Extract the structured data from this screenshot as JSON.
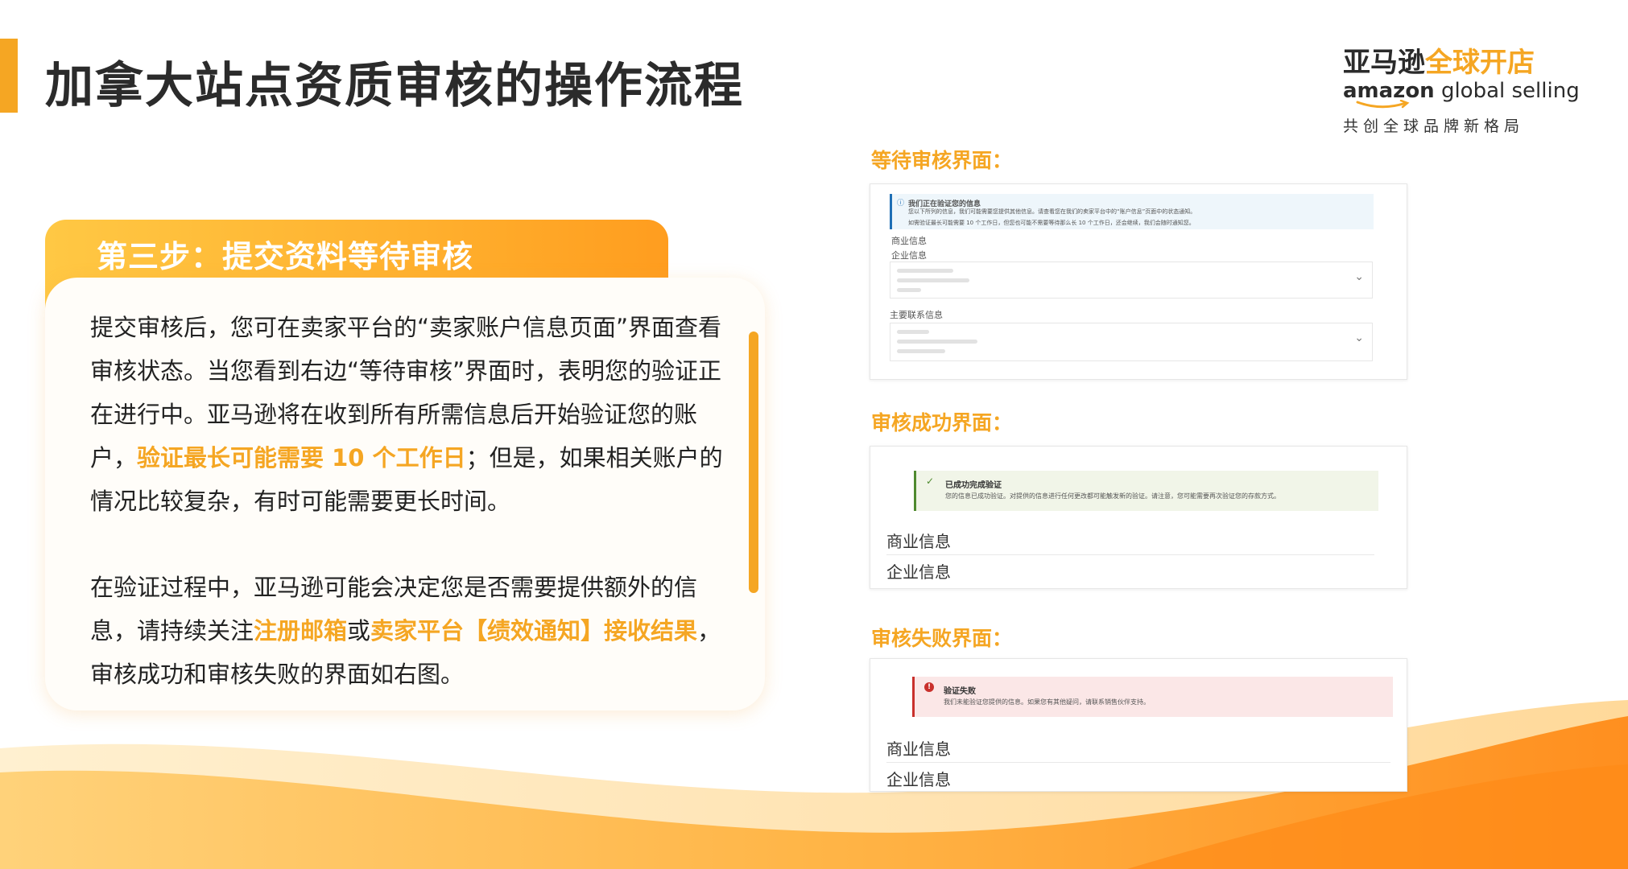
{
  "page": {
    "title": "加拿大站点资质审核的操作流程"
  },
  "logo": {
    "cn_part1": "亚马逊",
    "cn_part2": "全球开店",
    "en_part1": "amazon",
    "en_part2": " global selling",
    "tagline": "共创全球品牌新格局"
  },
  "step": {
    "title": "第三步：提交资料等待审核",
    "para1": {
      "text1": "提交审核后，您可在卖家平台的“卖家账户信息页面”界面查看审核状态。当您看到右边“等待审核”界面时，表明您的验证正在进行中。亚马逊将在收到所有所需信息后开始验证您的账户，",
      "highlight1": "验证最长可能需要 10 个工作日",
      "text2": "；但是，如果相关账户的情况比较复杂，有时可能需要更长时间。"
    },
    "para2": {
      "text1": "在验证过程中，亚马逊可能会决定您是否需要提供额外的信息，请持续关注",
      "highlight1": "注册邮箱",
      "text2": "或",
      "highlight2": "卖家平台【绩效通知】接收结果",
      "text3": "，审核成功和审核失败的界面如右图。"
    }
  },
  "screens": {
    "pending": {
      "label": "等待审核界面：",
      "notice_title": "我们正在验证您的信息",
      "notice_line1": "您以下所列的信息，我们可能需要您提供其他信息。请查看您在我们的卖家平台中的“账户信息”页面中的状态通知。",
      "notice_line2": "如需验证最长可能需要 10 个工作日，但您也可能不需要等待那么长 10 个工作日，还会继续，我们会随时通知您。",
      "section1": "商业信息",
      "section2": "企业信息",
      "section3": "主要联系信息"
    },
    "success": {
      "label": "审核成功界面：",
      "notice_title": "已成功完成验证",
      "notice_line1": "您的信息已成功验证。对提供的信息进行任何更改都可能触发新的验证。请注意，您可能需要再次验证您的存款方式。",
      "section1": "商业信息",
      "section2": "企业信息"
    },
    "failure": {
      "label": "审核失败界面：",
      "notice_title": "验证失败",
      "notice_line1": "我们未能验证您提供的信息。如果您有其他疑问，请联系销售伙伴支持。",
      "section1": "商业信息",
      "section2": "企业信息"
    }
  },
  "colors": {
    "accent": "#f5a623",
    "info_border": "#1f6fb5",
    "info_bg": "#eef6fb",
    "success_border": "#4f8a2f",
    "success_bg": "#f1f5e8",
    "error_border": "#c9302c",
    "error_bg": "#fbe7e7"
  },
  "icons": [
    "info-icon",
    "check-icon",
    "error-icon",
    "chevron-down-icon",
    "amazon-smile-icon"
  ]
}
